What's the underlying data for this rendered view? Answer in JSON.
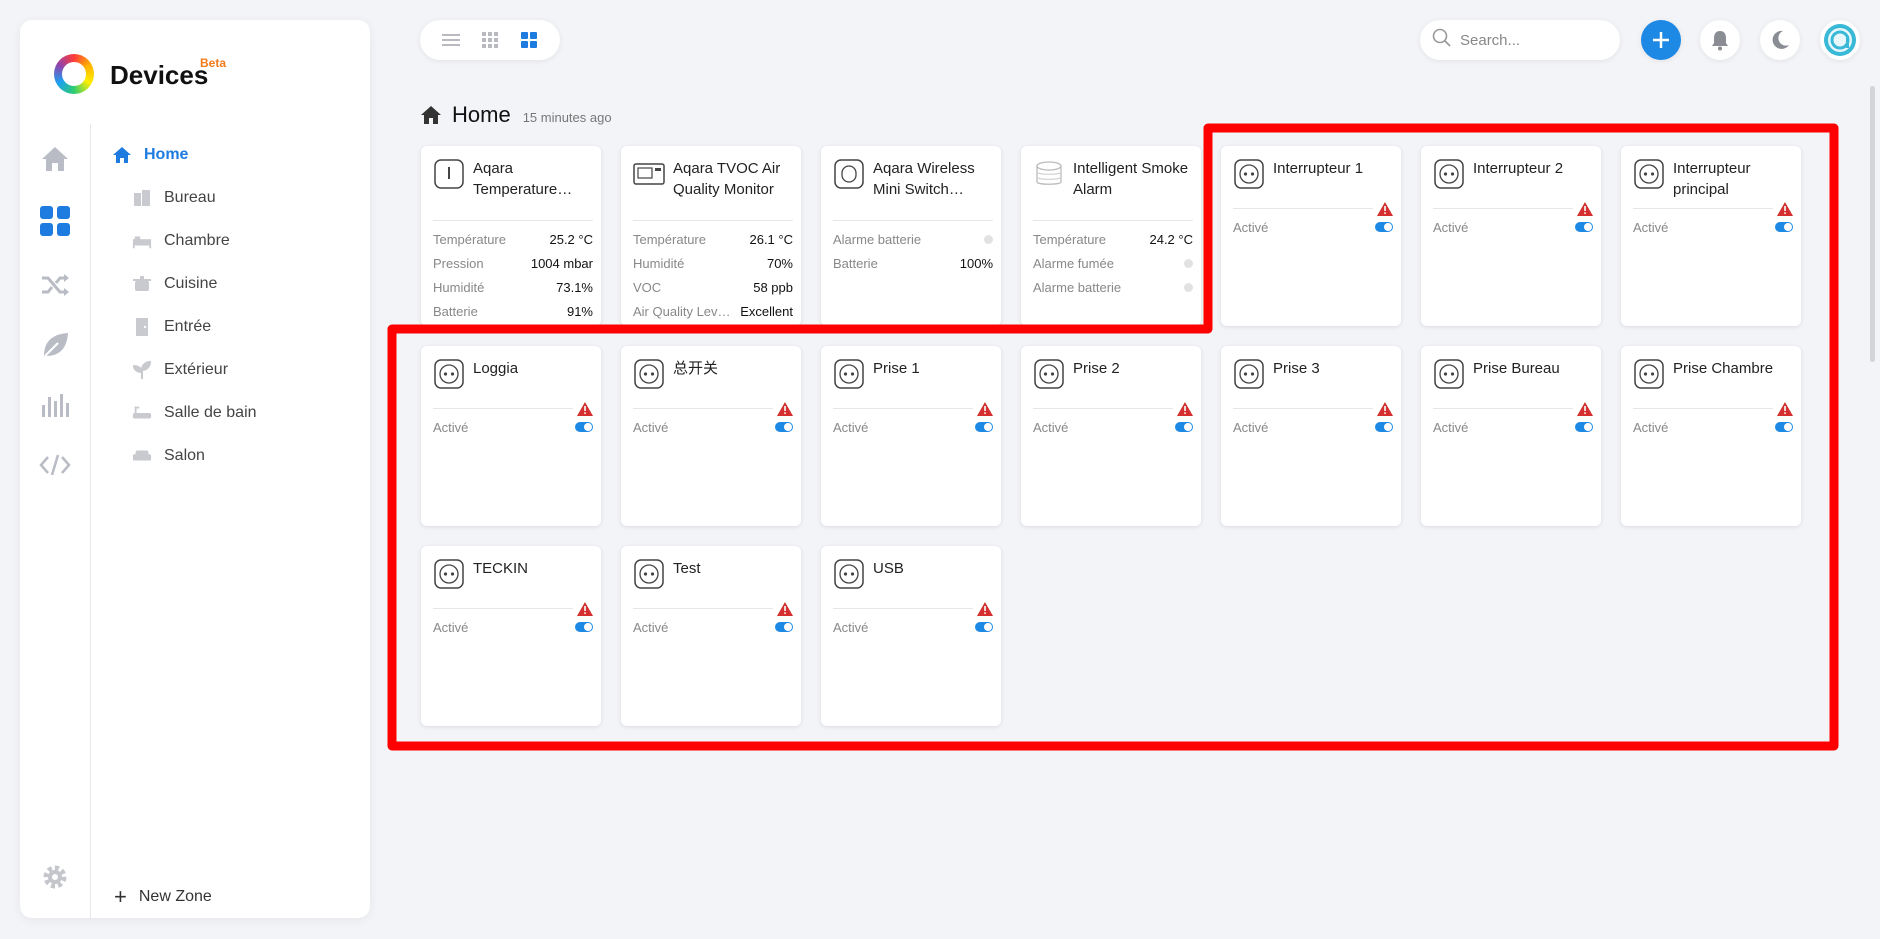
{
  "app": {
    "title": "Devices",
    "badge": "Beta",
    "accent": "#1e88e5"
  },
  "sidebar": {
    "rail": [
      {
        "name": "home-icon",
        "active": false
      },
      {
        "name": "devices-grid-icon",
        "active": true
      },
      {
        "name": "shuffle-icon",
        "active": false
      },
      {
        "name": "leaf-icon",
        "active": false
      },
      {
        "name": "chart-bars-icon",
        "active": false
      },
      {
        "name": "code-icon",
        "active": false
      }
    ],
    "zones": [
      {
        "label": "Home",
        "icon": "home-icon",
        "active": true
      },
      {
        "label": "Bureau",
        "icon": "office-icon"
      },
      {
        "label": "Chambre",
        "icon": "bed-icon"
      },
      {
        "label": "Cuisine",
        "icon": "pot-icon"
      },
      {
        "label": "Entrée",
        "icon": "door-icon"
      },
      {
        "label": "Extérieur",
        "icon": "plant-icon"
      },
      {
        "label": "Salle de bain",
        "icon": "bath-icon"
      },
      {
        "label": "Salon",
        "icon": "sofa-icon"
      }
    ],
    "new_zone": "New Zone"
  },
  "toolbar": {
    "search_placeholder": "Search..."
  },
  "breadcrumb": {
    "title": "Home",
    "updated": "15 minutes ago"
  },
  "sensor_cards": [
    {
      "name": "Aqara Temperature…",
      "icon": "thermometer-icon",
      "rows": [
        {
          "label": "Température",
          "value": "25.2 °C"
        },
        {
          "label": "Pression",
          "value": "1004 mbar"
        },
        {
          "label": "Humidité",
          "value": "73.1%"
        },
        {
          "label": "Batterie",
          "value": "91%"
        }
      ]
    },
    {
      "name": "Aqara TVOC Air Quality Monitor",
      "icon": "air-monitor-icon",
      "rows": [
        {
          "label": "Température",
          "value": "26.1 °C"
        },
        {
          "label": "Humidité",
          "value": "70%"
        },
        {
          "label": "VOC",
          "value": "58 ppb"
        },
        {
          "label": "Air Quality Lev…",
          "value": "Excellent"
        }
      ]
    },
    {
      "name": "Aqara Wireless Mini Switch…",
      "icon": "wireless-switch-icon",
      "rows": [
        {
          "label": "Alarme batterie",
          "value": "",
          "dot": true
        },
        {
          "label": "Batterie",
          "value": "100%"
        }
      ]
    },
    {
      "name": "Intelligent Smoke Alarm",
      "icon": "smoke-alarm-icon",
      "rows": [
        {
          "label": "Température",
          "value": "24.2 °C"
        },
        {
          "label": "Alarme fumée",
          "value": "",
          "dot": true
        },
        {
          "label": "Alarme batterie",
          "value": "",
          "dot": true
        }
      ]
    }
  ],
  "switch_cards": [
    {
      "name": "Interrupteur 1",
      "state": "Activé"
    },
    {
      "name": "Interrupteur 2",
      "state": "Activé"
    },
    {
      "name": "Interrupteur principal",
      "state": "Activé"
    },
    {
      "name": "Loggia",
      "state": "Activé"
    },
    {
      "name": "总开关",
      "state": "Activé"
    },
    {
      "name": "Prise 1",
      "state": "Activé"
    },
    {
      "name": "Prise 2",
      "state": "Activé"
    },
    {
      "name": "Prise 3",
      "state": "Activé"
    },
    {
      "name": "Prise Bureau",
      "state": "Activé"
    },
    {
      "name": "Prise Chambre",
      "state": "Activé"
    },
    {
      "name": "TECKIN",
      "state": "Activé"
    },
    {
      "name": "Test",
      "state": "Activé"
    },
    {
      "name": "USB",
      "state": "Activé"
    }
  ],
  "colors": {
    "highlight": "#ff0000",
    "warning": "#d32f2f",
    "toggle_on": "#1e88e5"
  }
}
